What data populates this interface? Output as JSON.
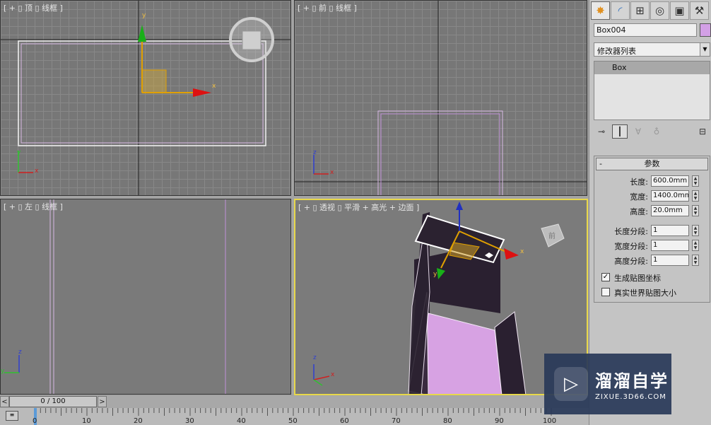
{
  "viewports": {
    "top": {
      "label": "[ + ▯ 顶 ▯ 线框 ]"
    },
    "front": {
      "label": "[ + ▯ 前 ▯ 线框 ]"
    },
    "left": {
      "label": "[ + ▯ 左 ▯ 线框 ]"
    },
    "perspective": {
      "label": "[ + ▯ 透视 ▯ 平滑 + 高光 + 边面 ]"
    }
  },
  "axis_labels": {
    "x": "x",
    "y": "y",
    "z": "z"
  },
  "viewcube_label": "前",
  "panel": {
    "tabs": [
      "create-icon",
      "modify-icon",
      "hierarchy-icon",
      "motion-icon",
      "display-icon",
      "utilities-icon"
    ],
    "object_name": "Box004",
    "object_color": "#d3a0e6",
    "modifier_list": "修改器列表",
    "stack_items": [
      "Box"
    ],
    "rollout_title": "参数",
    "params": [
      {
        "label": "长度:",
        "value": "600.0mm"
      },
      {
        "label": "宽度:",
        "value": "1400.0mm"
      },
      {
        "label": "高度:",
        "value": "20.0mm"
      }
    ],
    "segments": [
      {
        "label": "长度分段:",
        "value": "1"
      },
      {
        "label": "宽度分段:",
        "value": "1"
      },
      {
        "label": "高度分段:",
        "value": "1"
      }
    ],
    "checkboxes": [
      {
        "label": "生成贴图坐标",
        "checked": true
      },
      {
        "label": "真实世界贴图大小",
        "checked": false
      }
    ]
  },
  "timeline": {
    "position": "0 / 100",
    "prev": "<",
    "next": ">",
    "ticks": [
      "0",
      "10",
      "20",
      "30",
      "40",
      "50",
      "60",
      "70",
      "80",
      "90",
      "100"
    ]
  },
  "watermark": {
    "title": "溜溜自学",
    "url": "ZIXUE.3D66.COM"
  }
}
